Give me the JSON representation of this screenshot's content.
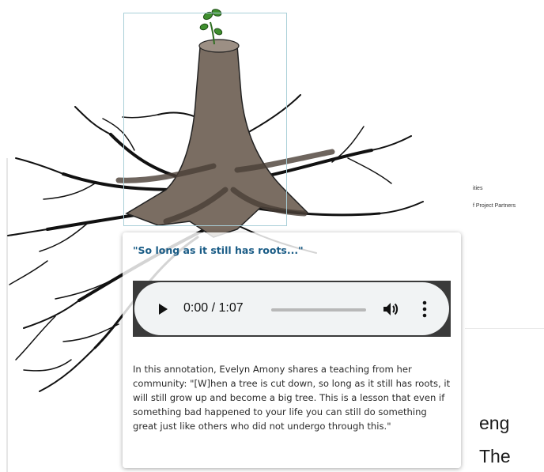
{
  "background": {
    "side_text_1": "ities",
    "side_text_2": "f Project Partners",
    "side_text_3": "",
    "big_text_1": "eng",
    "big_text_2": "The"
  },
  "popup": {
    "title": "\"So long as it still has roots...\"",
    "audio": {
      "current_time": "0:00",
      "duration": "1:07",
      "time_display": "0:00 / 1:07",
      "progress": 0.0,
      "play_icon": "play-icon",
      "volume_icon": "volume-icon",
      "menu_icon": "more-options-icon"
    },
    "body": "In this annotation, Evelyn Amony shares a teaching from her community: \"[W]hen a tree is cut down, so long as it still has roots, it will still grow up and become a big tree. This is a lesson that even if something bad happened to your life you can still do something great just like others who did not undergo through this.\""
  },
  "colors": {
    "title": "#1a5c86",
    "annotation_border": "#a9cfd8",
    "trunk": "#6e6258",
    "sprout": "#3f8f2e"
  }
}
